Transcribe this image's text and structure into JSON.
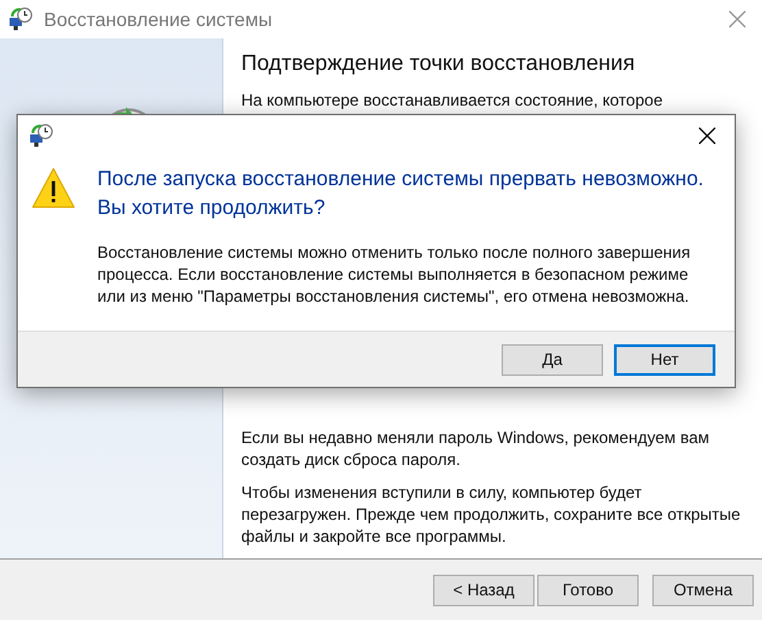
{
  "window": {
    "title": "Восстановление системы"
  },
  "page": {
    "heading": "Подтверждение точки восстановления",
    "intro": "На компьютере восстанавливается состояние, которое",
    "notes": [
      "Если вы недавно меняли пароль Windows, рекомендуем вам создать диск сброса пароля.",
      "Чтобы изменения вступили в силу, компьютер будет перезагружен. Прежде чем продолжить, сохраните все открытые файлы и закройте все программы."
    ]
  },
  "buttons": [
    {
      "label": "< Назад",
      "default": false
    },
    {
      "label": "Готово",
      "default": false
    },
    {
      "label": "Отмена",
      "default": false
    }
  ],
  "dialog": {
    "heading": "После запуска восстановление системы прервать невозможно. Вы хотите продолжить?",
    "message": "Восстановление системы можно отменить только после полного завершения процесса. Если восстановление системы выполняется в безопасном режиме или из меню \"Параметры восстановления системы\", его отмена невозможна.",
    "buttons": [
      {
        "label": "Да",
        "default": false
      },
      {
        "label": "Нет",
        "default": true
      }
    ]
  }
}
